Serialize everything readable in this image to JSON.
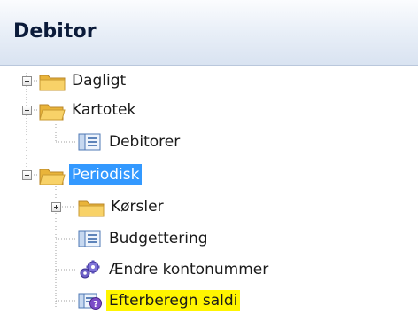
{
  "panel": {
    "title": "Debitor"
  },
  "tree": {
    "dagligt": {
      "label": "Dagligt",
      "state": "collapsed"
    },
    "kartotek": {
      "label": "Kartotek",
      "state": "expanded",
      "children": {
        "debitorer": {
          "label": "Debitorer"
        }
      }
    },
    "periodisk": {
      "label": "Periodisk",
      "state": "expanded",
      "selected": true,
      "children": {
        "korsler": {
          "label": "Kørsler",
          "state": "collapsed"
        },
        "budgettering": {
          "label": "Budgettering"
        },
        "aendre": {
          "label": "Ændre kontonummer"
        },
        "efterberegn": {
          "label": "Efterberegn saldi"
        }
      }
    }
  },
  "colors": {
    "selection": "#3399ff",
    "highlight": "#fff500",
    "folder": "#f4c74d"
  },
  "icons": {
    "folder": "folder-icon",
    "form": "form-icon",
    "process": "gears-icon",
    "recalc": "recalc-icon"
  }
}
